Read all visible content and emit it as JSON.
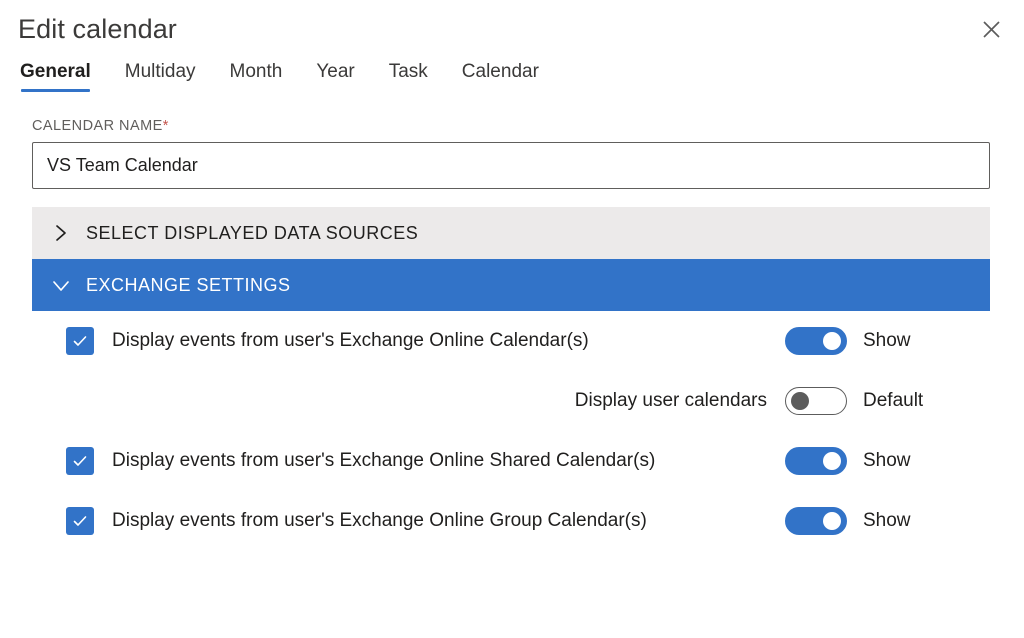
{
  "dialog": {
    "title": "Edit calendar",
    "close_label": "Close",
    "close_icon": "close-icon"
  },
  "tabs": [
    {
      "label": "General",
      "active": true
    },
    {
      "label": "Multiday",
      "active": false
    },
    {
      "label": "Month",
      "active": false
    },
    {
      "label": "Year",
      "active": false
    },
    {
      "label": "Task",
      "active": false
    },
    {
      "label": "Calendar",
      "active": false
    }
  ],
  "calendar_name_field": {
    "label": "CALENDAR NAME",
    "required_marker": "*",
    "value": "VS Team Calendar",
    "placeholder": ""
  },
  "sections": [
    {
      "title": "SELECT DISPLAYED DATA SOURCES",
      "state": "collapsed",
      "chevron_icon": "chevron-right-icon",
      "background": "#eceaea"
    },
    {
      "title": "EXCHANGE SETTINGS",
      "state": "expanded",
      "chevron_icon": "chevron-down-icon",
      "background": "#3273c8"
    }
  ],
  "exchange_options": [
    {
      "checkbox_checked": true,
      "label": "Display events from user's Exchange Online Calendar(s)",
      "toggle_on": true,
      "toggle_text": "Show"
    },
    {
      "sub_label": "Display user calendars",
      "toggle_on": false,
      "toggle_text": "Default"
    },
    {
      "checkbox_checked": true,
      "label": "Display events from user's Exchange Online Shared Calendar(s)",
      "toggle_on": true,
      "toggle_text": "Show"
    },
    {
      "checkbox_checked": true,
      "label": "Display events from user's Exchange Online Group Calendar(s)",
      "toggle_on": true,
      "toggle_text": "Show"
    }
  ],
  "colors": {
    "accent_blue": "#3273c8",
    "section_gray": "#eceaea",
    "text_primary": "#201f1e",
    "text_secondary": "#605e5c",
    "required_red": "#c4554d"
  }
}
